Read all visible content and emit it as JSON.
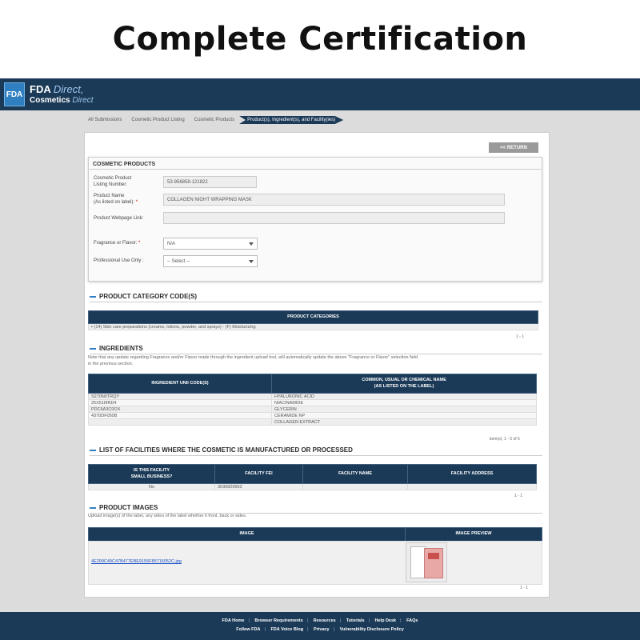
{
  "banner": {
    "title": "Complete Certification"
  },
  "header": {
    "logo": "FDA",
    "brand_main": "FDA",
    "brand_main_suffix": "Direct,",
    "brand_sub": "Cosmetics",
    "brand_sub_suffix": "Direct"
  },
  "breadcrumb": [
    "All Submissions",
    "Cosmetic Product Listing",
    "Cosmetic Products",
    "Product(s), Ingredient(s), and Facility(ies)"
  ],
  "return_label": "<< RETURN",
  "cosmetic_products": {
    "title": "COSMETIC PRODUCTS",
    "listing_label_1": "Cosmetic Product",
    "listing_label_2": "Listing Number:",
    "listing_value": "53-956858-121822",
    "name_label_1": "Product Name",
    "name_label_2": "(As listed on label):",
    "name_value": "COLLAGEN NIGHT WRAPPING MASK",
    "webpage_label": "Product Webpage Link:",
    "webpage_value": "",
    "fragrance_label": "Fragrance or Flavor:",
    "fragrance_value": "N/A",
    "professional_label": "Professional Use Only :",
    "professional_value": "-- Select --",
    "required_mark": "*"
  },
  "category": {
    "title": "PRODUCT CATEGORY CODE(S)",
    "column": "PRODUCT CATEGORIES",
    "row": "(14) Skin care preparations (creams, lotions, powder, and sprays) - (F) Moisturizing",
    "count": "1 - 1"
  },
  "ingredients": {
    "title": "INGREDIENTS",
    "note_1": "Note that any update regarding Fragrance and/or Flavor made through the ingredient upload tool, will automatically update the above \"Fragrance or Flavor\" selection field",
    "note_2": "in the previous section.",
    "col_1": "INGREDIENT UNII CODE(S)",
    "col_2a": "COMMON, USUAL OR CHEMICAL NAME",
    "col_2b": "(AS LISTED ON THE LABEL)",
    "rows": [
      [
        "S270N0TRQY",
        "HYALURONIC ACID"
      ],
      [
        "25X51I8RD4",
        "NIACINAMIDE"
      ],
      [
        "PDC6A3C0OX",
        "GLYCERIN"
      ],
      [
        "4370DF050B",
        "CERAMIDE NP"
      ],
      [
        "",
        "COLLAGEN EXTRACT"
      ]
    ],
    "count": "item(s): 1 - 5 of 5"
  },
  "facilities": {
    "title": "LIST OF FACILITIES WHERE THE COSMETIC IS MANUFACTURED OR PROCESSED",
    "col_1a": "IS THIS FACILITY",
    "col_1b": "SMALL BUSINESS?",
    "col_2": "FACILITY FEI",
    "col_3": "FACILITY NAME",
    "col_4": "FACILITY ADDRESS",
    "row": [
      "No",
      "3030829953",
      "",
      ""
    ],
    "count": "1 - 1"
  },
  "images": {
    "title": "PRODUCT IMAGES",
    "note": "Upload image(s) of the label, any sides of the label whether it front, back or sides.",
    "col_1": "IMAGE",
    "col_2": "IMAGE PREVIEW",
    "file": "4E299C49C47B477EBE9155F85716052C.jpg",
    "count": "1 - 1"
  },
  "footer": {
    "row1": [
      "FDA Home",
      "Browser Requirements",
      "Resources",
      "Tutorials",
      "Help Desk",
      "FAQs"
    ],
    "row2": [
      "Follow FDA",
      "FDA Voice Blog",
      "Privacy",
      "Vulnerability Disclosure Policy"
    ],
    "separator": "|"
  }
}
